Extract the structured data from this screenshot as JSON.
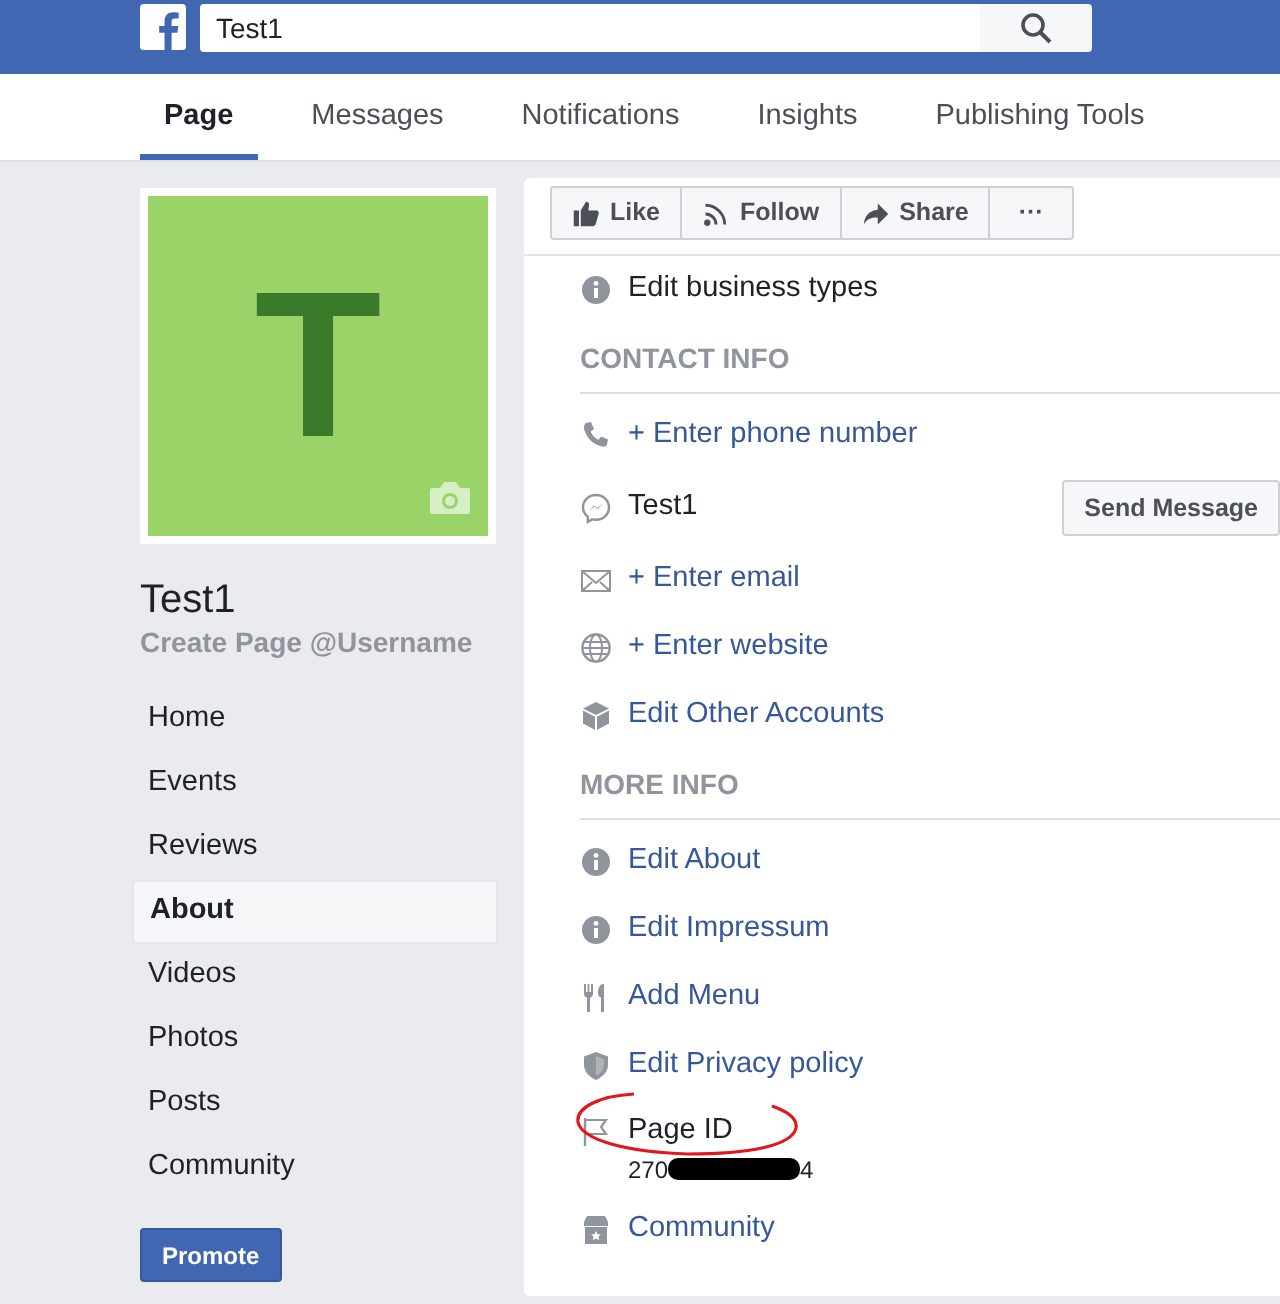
{
  "header": {
    "search_value": "Test1"
  },
  "tabs": [
    {
      "label": "Page",
      "selected": true
    },
    {
      "label": "Messages",
      "selected": false
    },
    {
      "label": "Notifications",
      "selected": false
    },
    {
      "label": "Insights",
      "selected": false
    },
    {
      "label": "Publishing Tools",
      "selected": false
    }
  ],
  "sidebar": {
    "avatar_letter": "T",
    "page_name": "Test1",
    "username_link": "Create Page @Username",
    "nav": [
      {
        "label": "Home",
        "selected": false
      },
      {
        "label": "Events",
        "selected": false
      },
      {
        "label": "Reviews",
        "selected": false
      },
      {
        "label": "About",
        "selected": true
      },
      {
        "label": "Videos",
        "selected": false
      },
      {
        "label": "Photos",
        "selected": false
      },
      {
        "label": "Posts",
        "selected": false
      },
      {
        "label": "Community",
        "selected": false
      }
    ],
    "promote_button": "Promote"
  },
  "actions": [
    {
      "kind": "like",
      "label": "Like"
    },
    {
      "kind": "follow",
      "label": "Follow"
    },
    {
      "kind": "share",
      "label": "Share"
    },
    {
      "kind": "more",
      "label": "···"
    }
  ],
  "about_rows": [
    {
      "kind": "info",
      "label": "Edit business types",
      "link": false
    },
    {
      "kind": "heading",
      "label": "CONTACT INFO"
    },
    {
      "kind": "phone",
      "label": "+ Enter phone number",
      "link": true
    },
    {
      "kind": "messenger",
      "label": "Test1",
      "link": false,
      "button": "Send Message"
    },
    {
      "kind": "email",
      "label": "+ Enter email",
      "link": true
    },
    {
      "kind": "website",
      "label": "+ Enter website",
      "link": true
    },
    {
      "kind": "accounts",
      "label": "Edit Other Accounts",
      "link": true
    },
    {
      "kind": "heading",
      "label": "MORE INFO"
    },
    {
      "kind": "info",
      "label": "Edit About",
      "link": true
    },
    {
      "kind": "info",
      "label": "Edit Impressum",
      "link": true
    },
    {
      "kind": "menu",
      "label": "Add Menu",
      "link": true
    },
    {
      "kind": "privacy",
      "label": "Edit Privacy policy",
      "link": true
    },
    {
      "kind": "page-id",
      "label": "Page ID",
      "link": false,
      "value_parts": [
        "270",
        "4"
      ],
      "redacted": true,
      "circled": true
    },
    {
      "kind": "community",
      "label": "Community",
      "link": true
    }
  ]
}
